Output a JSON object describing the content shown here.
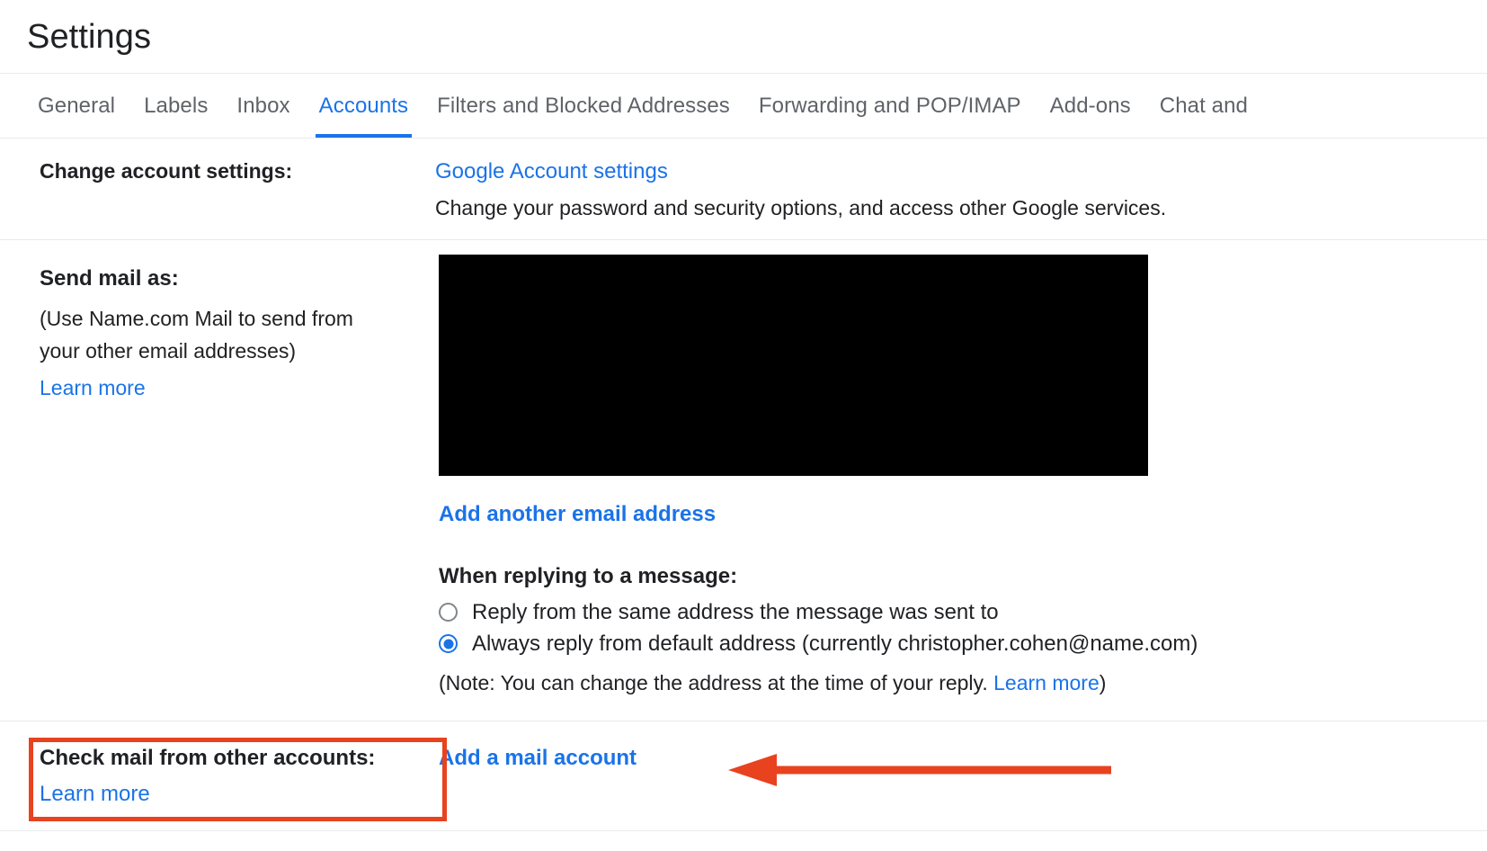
{
  "header": {
    "title": "Settings"
  },
  "tabs": [
    {
      "label": "General",
      "active": false
    },
    {
      "label": "Labels",
      "active": false
    },
    {
      "label": "Inbox",
      "active": false
    },
    {
      "label": "Accounts",
      "active": true
    },
    {
      "label": "Filters and Blocked Addresses",
      "active": false
    },
    {
      "label": "Forwarding and POP/IMAP",
      "active": false
    },
    {
      "label": "Add-ons",
      "active": false
    },
    {
      "label": "Chat and",
      "active": false
    }
  ],
  "rows": {
    "change_account": {
      "label": "Change account settings:",
      "link": "Google Account settings",
      "description": "Change your password and security options, and access other Google services."
    },
    "send_mail_as": {
      "label": "Send mail as:",
      "note": "(Use Name.com Mail to send from your other email addresses)",
      "learn_more": "Learn more",
      "redacted": "",
      "add_another": "Add another email address",
      "when_replying_title": "When replying to a message:",
      "option_same": "Reply from the same address the message was sent to",
      "option_default": "Always reply from default address (currently christopher.cohen@name.com)",
      "note_prefix": "(Note: You can change the address at the time of your reply. ",
      "note_link": "Learn more",
      "note_suffix": ")"
    },
    "check_mail": {
      "label": "Check mail from other accounts:",
      "learn_more": "Learn more",
      "add_account": "Add a mail account"
    }
  },
  "annotations": {
    "highlight_color": "#e8421f",
    "arrow_color": "#e8421f",
    "arrow_direction": "left"
  },
  "colors": {
    "link": "#1a73e8",
    "text": "#202124",
    "muted": "#5f6368",
    "divider": "#e8eaed",
    "redaction": "#000000"
  }
}
